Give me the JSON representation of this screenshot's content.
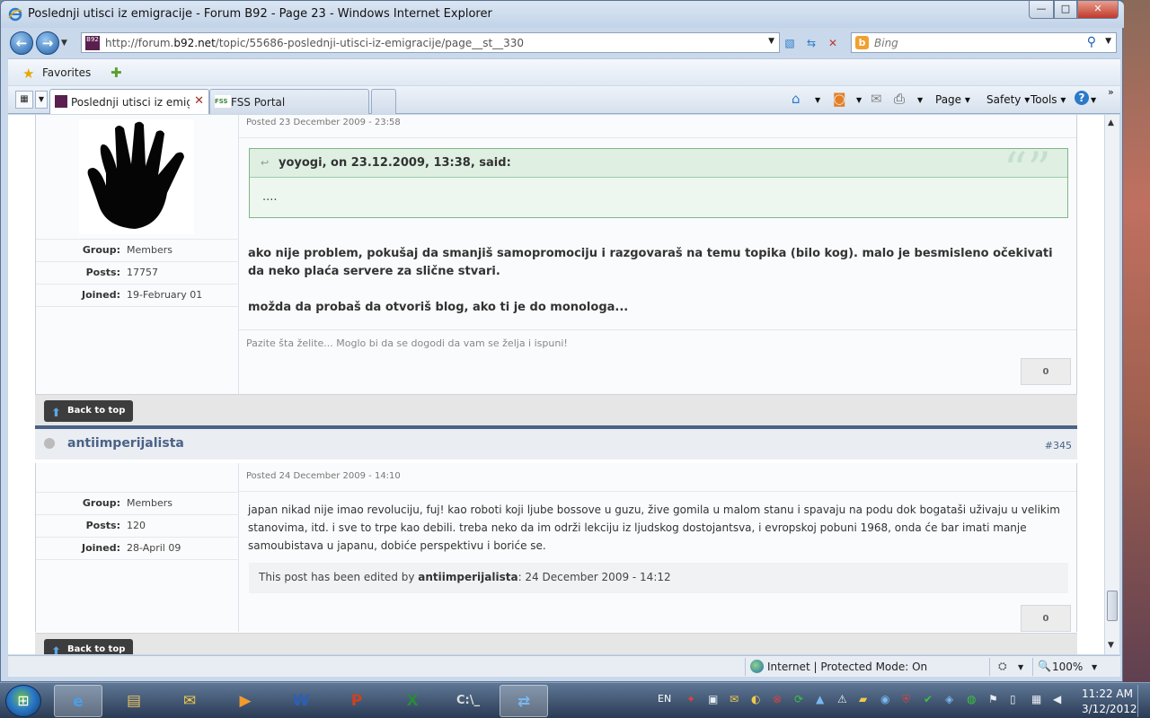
{
  "window": {
    "title": "Poslednji utisci iz emigracije - Forum B92 - Page 23 - Windows Internet Explorer",
    "controls": {
      "minimize": "—",
      "maximize": "□",
      "close": "✕"
    }
  },
  "address": {
    "url_prefix": "http://forum.",
    "url_domain": "b92.net",
    "url_path": "/topic/55686-poslednji-utisci-iz-emigracije/page__st__330"
  },
  "search": {
    "placeholder": "Bing"
  },
  "favorites": {
    "label": "Favorites"
  },
  "tabs": [
    {
      "label": "Poslednji utisci iz emigr...",
      "active": true
    },
    {
      "label": "FSS Portal",
      "active": false,
      "favicon_text": "FSS"
    }
  ],
  "commandbar": {
    "page": "Page",
    "safety": "Safety",
    "tools": "Tools",
    "help": "?"
  },
  "posts": [
    {
      "posted": "Posted 23 December 2009 - 23:58",
      "author_info": [
        {
          "label": "Group:",
          "value": "Members"
        },
        {
          "label": "Posts:",
          "value": "17757"
        },
        {
          "label": "Joined:",
          "value": "19-February 01"
        }
      ],
      "quote": {
        "cite": "yoyogi, on 23.12.2009, 13:38, said:",
        "text": "...."
      },
      "body_p1": "ako nije problem, pokušaj da smanjiš samopromociju i razgovaraš na temu topika (bilo kog). malo je besmisleno očekivati da neko plaća servere za slične stvari.",
      "body_p2": "možda da probaš da otvoriš blog, ako ti je do monologa...",
      "signature": "Pazite šta želite... Moglo bi da se dogodi da vam se želja i ispuni!",
      "reputation": "0"
    },
    {
      "username": "antiimperijalista",
      "post_number": "#345",
      "posted": "Posted 24 December 2009 - 14:10",
      "author_info": [
        {
          "label": "Group:",
          "value": "Members"
        },
        {
          "label": "Posts:",
          "value": "120"
        },
        {
          "label": "Joined:",
          "value": "28-April 09"
        }
      ],
      "body": "japan nikad nije imao revoluciju, fuj! kao roboti koji ljube bossove u guzu, žive gomila u malom stanu i spavaju na podu dok bogataši uživaju u velikim stanovima, itd. i sve to trpe kao debili. treba neko da im održi lekciju iz ljudskog dostojantsva, i evropskoj pobuni 1968, onda će bar imati manje samoubistava u japanu, dobiće perspektivu i boriće se.",
      "edit_prefix": "This post has been edited by ",
      "edit_author": "antiimperijalista",
      "edit_suffix": ": 24 December 2009 - 14:12",
      "reputation": "0"
    }
  ],
  "back_to_top": "Back to top",
  "statusbar": {
    "zone": "Internet | Protected Mode: On",
    "zoom": "100%"
  },
  "taskbar": {
    "lang": "EN",
    "time": "11:22 AM",
    "date": "3/12/2012"
  },
  "colors": {
    "quote_bg": "#edf7ef",
    "quote_border": "#7fb58a",
    "post_header_accent": "#4a6288",
    "close_red": "#c0392b"
  }
}
